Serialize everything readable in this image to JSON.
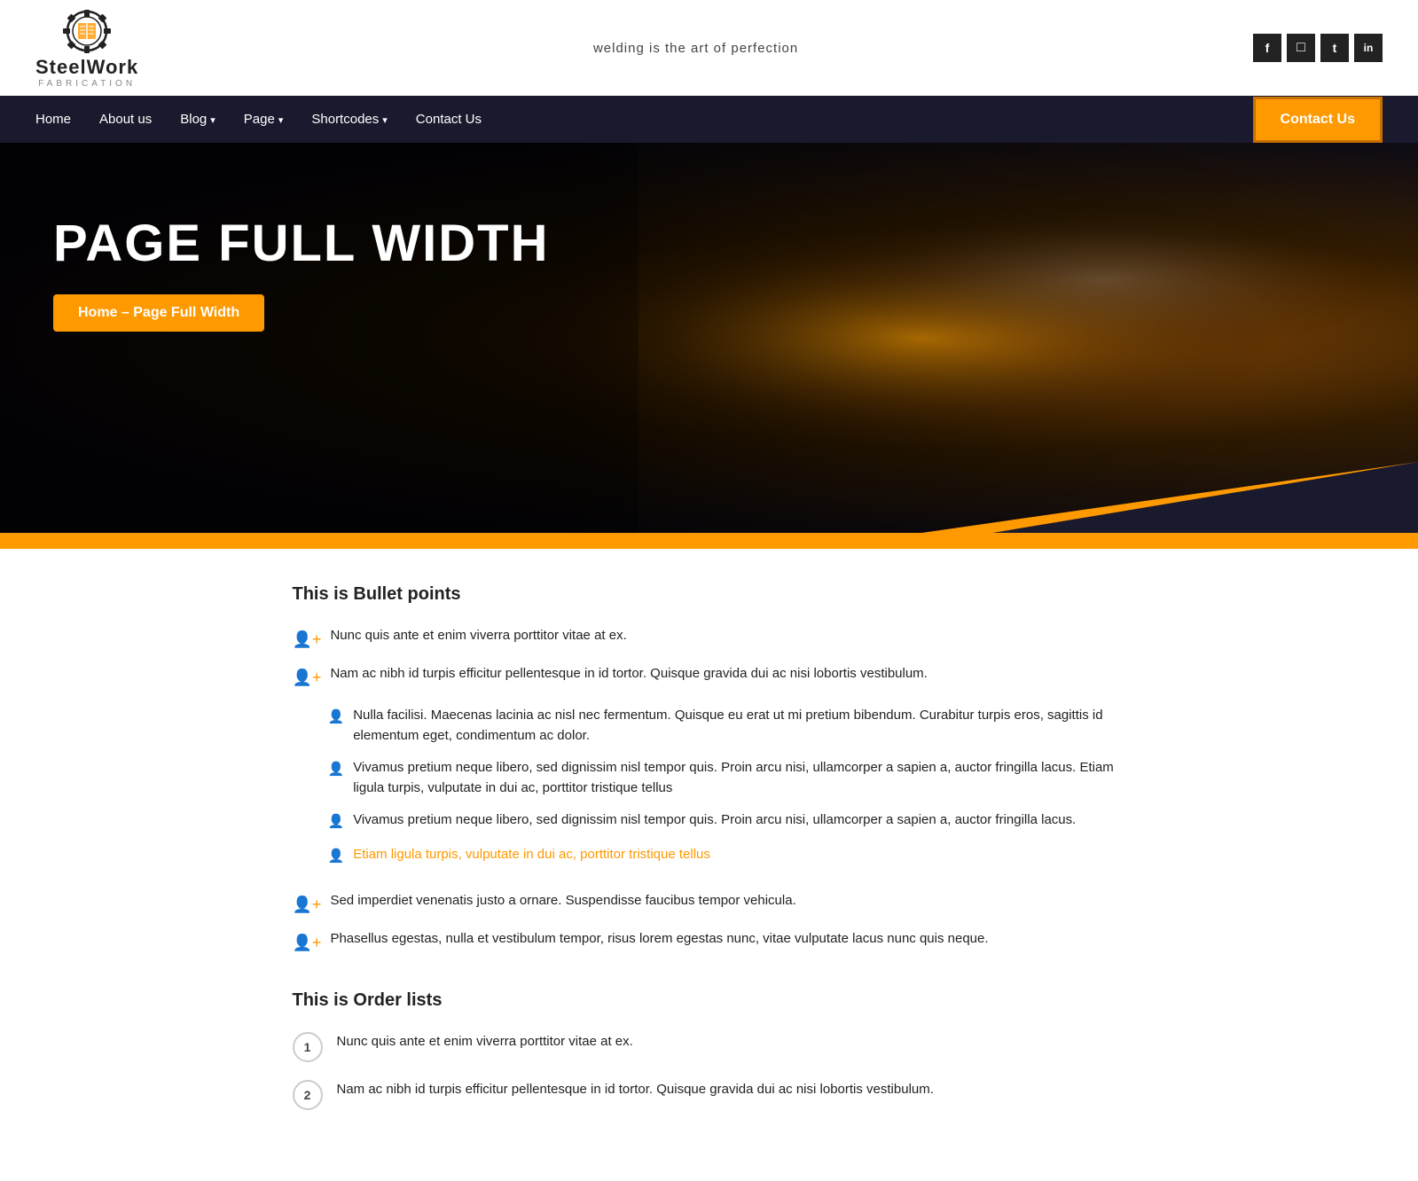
{
  "header": {
    "tagline": "welding is the art of perfection",
    "logo_text": "SteelWork",
    "logo_sub": "FABRICATION",
    "social_icons": [
      "f",
      "📷",
      "t",
      "in"
    ],
    "nav": {
      "links": [
        {
          "label": "Home",
          "has_dropdown": false
        },
        {
          "label": "About us",
          "has_dropdown": false
        },
        {
          "label": "Blog",
          "has_dropdown": true
        },
        {
          "label": "Page",
          "has_dropdown": true
        },
        {
          "label": "Shortcodes",
          "has_dropdown": true
        },
        {
          "label": "Contact Us",
          "has_dropdown": false
        }
      ],
      "cta_button": "Contact Us"
    }
  },
  "hero": {
    "title": "PAGE FULL WIDTH",
    "breadcrumb": "Home –  Page Full Width"
  },
  "content": {
    "bullet_section_title": "This is Bullet points",
    "bullet_items": [
      {
        "text": "Nunc quis ante et enim viverra porttitor vitae at ex.",
        "sub_items": []
      },
      {
        "text": "Nam ac nibh id turpis efficitur pellentesque in id tortor. Quisque gravida dui ac nisi lobortis vestibulum.",
        "sub_items": [
          {
            "text": "Nulla facilisi. Maecenas lacinia ac nisl nec fermentum. Quisque eu erat ut mi pretium bibendum. Curabitur turpis eros, sagittis id elementum eget, condimentum ac dolor.",
            "orange": false
          },
          {
            "text": "Vivamus pretium neque libero, sed dignissim nisl tempor quis. Proin arcu nisi, ullamcorper a sapien a, auctor fringilla lacus. Etiam ligula turpis, vulputate in dui ac, porttitor tristique tellus",
            "orange": false
          },
          {
            "text": "Vivamus pretium neque libero, sed dignissim nisl tempor quis. Proin arcu nisi, ullamcorper a sapien a, auctor fringilla lacus.",
            "orange": false
          },
          {
            "text": "Etiam ligula turpis, vulputate in dui ac, porttitor tristique tellus",
            "orange": true
          }
        ]
      },
      {
        "text": "Sed imperdiet venenatis justo a ornare. Suspendisse faucibus tempor vehicula.",
        "sub_items": []
      },
      {
        "text": "Phasellus egestas, nulla et vestibulum tempor, risus lorem egestas nunc, vitae vulputate lacus nunc quis neque.",
        "sub_items": []
      }
    ],
    "order_section_title": "This is Order lists",
    "order_items": [
      "Nunc quis ante et enim viverra porttitor vitae at ex.",
      "Nam ac nibh id turpis efficitur pellentesque in id tortor. Quisque gravida dui ac nisi lobortis vestibulum."
    ]
  }
}
